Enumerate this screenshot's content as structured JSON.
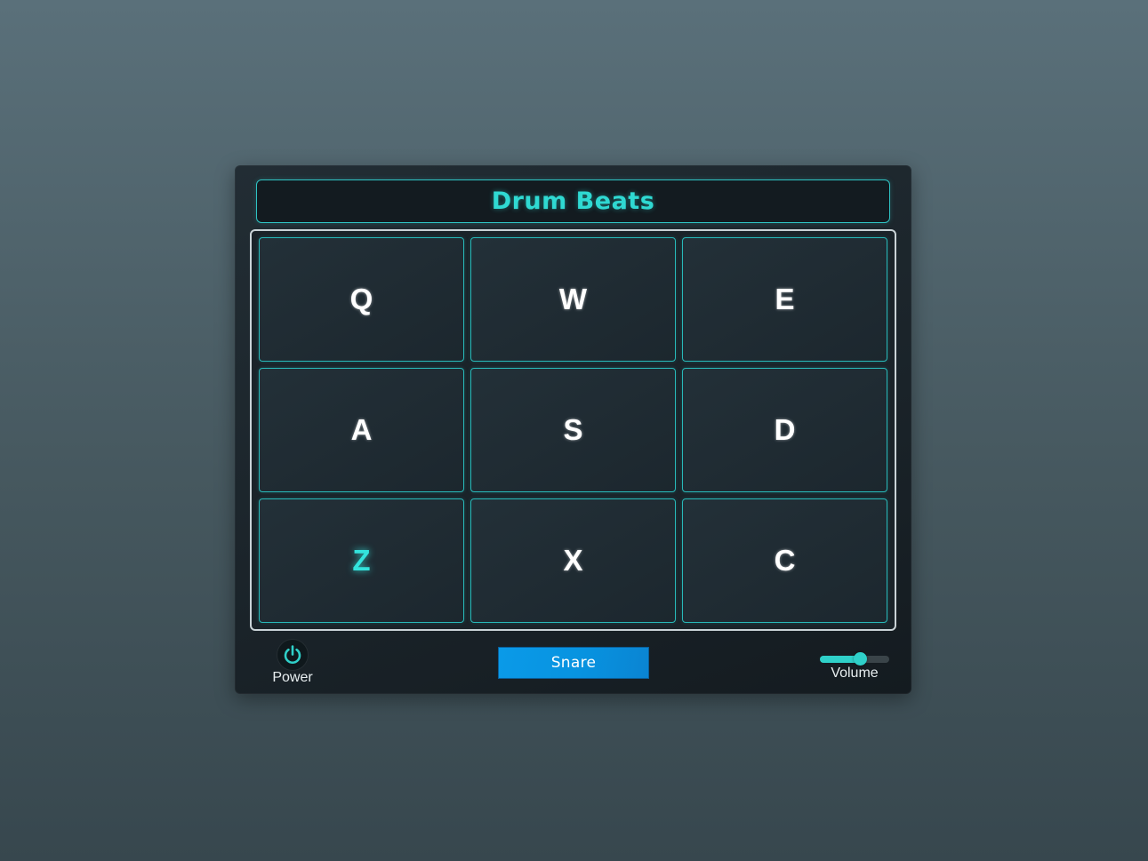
{
  "app": {
    "title": "Drum Beats"
  },
  "pads": [
    {
      "key": "Q",
      "active": false
    },
    {
      "key": "W",
      "active": false
    },
    {
      "key": "E",
      "active": false
    },
    {
      "key": "A",
      "active": false
    },
    {
      "key": "S",
      "active": false
    },
    {
      "key": "D",
      "active": false
    },
    {
      "key": "Z",
      "active": true
    },
    {
      "key": "X",
      "active": false
    },
    {
      "key": "C",
      "active": false
    }
  ],
  "controls": {
    "power_label": "Power",
    "power_icon": "power-icon",
    "power_on": true,
    "display_text": "Snare",
    "volume_label": "Volume",
    "volume_level": 0.58
  },
  "colors": {
    "accent": "#2fd9d2",
    "pad_border": "#28b9b9",
    "display_bg": "#0a9ae8"
  }
}
